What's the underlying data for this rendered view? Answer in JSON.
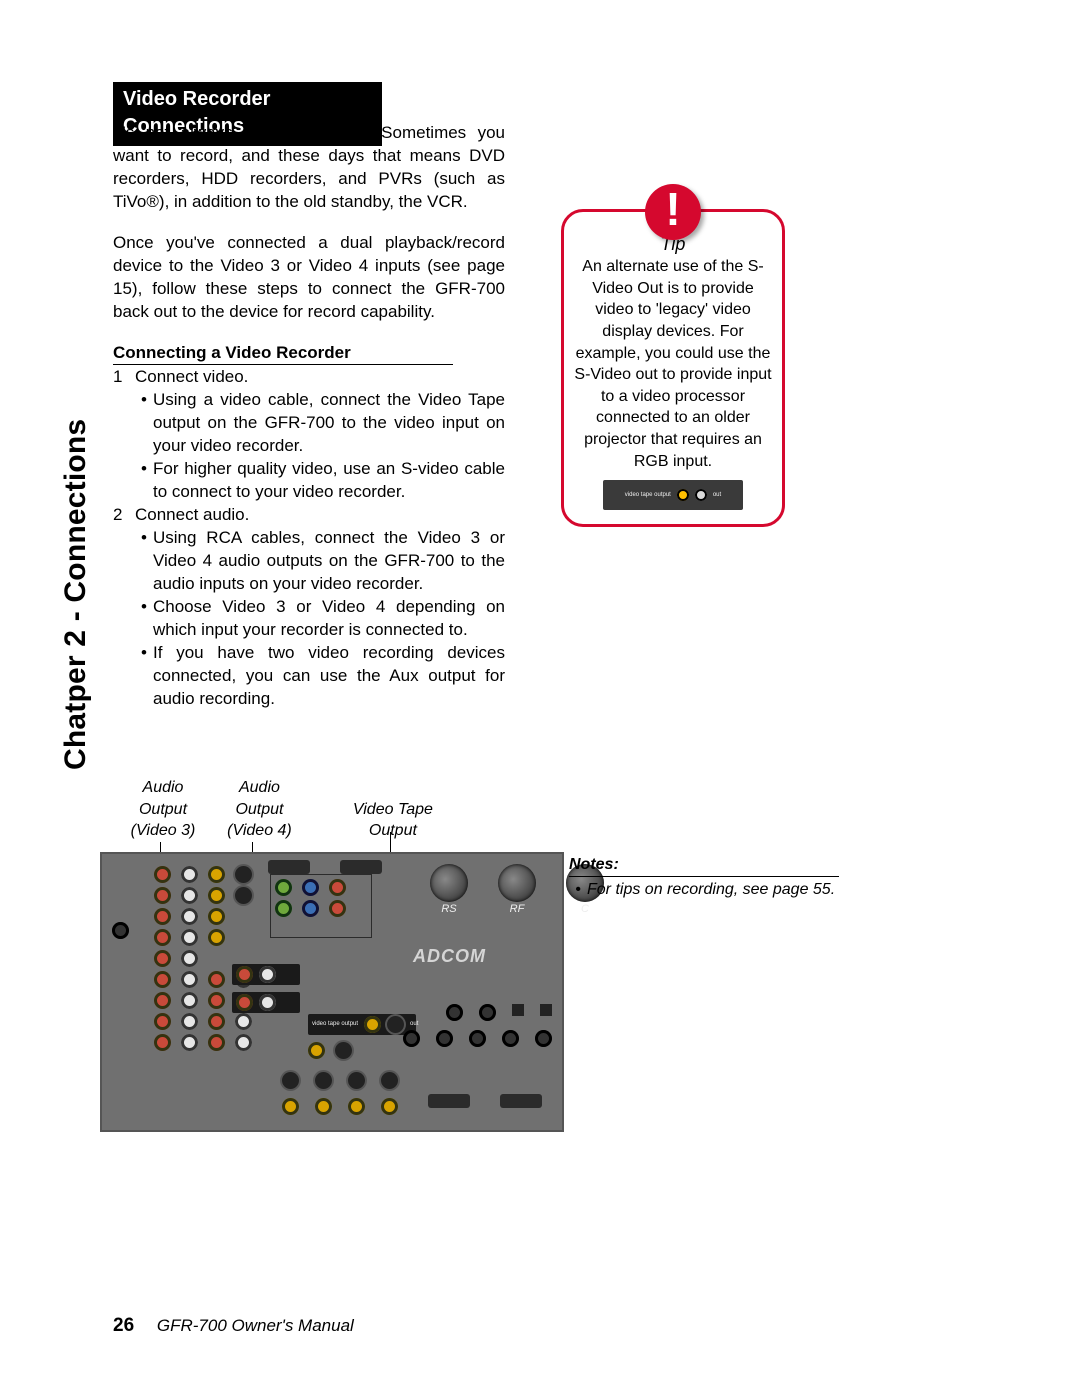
{
  "side_tab": "Chatper 2 - Connections",
  "section_title": "Video Recorder Connections",
  "intro_p1": "It's not always about playback. Sometimes you want to record, and these days that means DVD recorders, HDD recorders, and PVRs (such as TiVo®), in addition to the old standby, the VCR.",
  "intro_p2": "Once you've connected a dual playback/record device to the Video 3 or Video 4 inputs (see page 15), follow these steps to connect the GFR-700 back out to the device for record capability.",
  "sub_header": "Connecting a Video Recorder",
  "steps": [
    {
      "num": "1",
      "title": "Connect video.",
      "bullets": [
        "Using a video cable, connect the Video Tape output on the GFR-700 to the video input on your video recorder.",
        "For higher quality video, use an S-video cable to connect to your video recorder."
      ]
    },
    {
      "num": "2",
      "title": "Connect audio.",
      "bullets": [
        "Using RCA cables, connect the Video 3 or Video 4 audio outputs  on the GFR-700 to the audio inputs on your video recorder.",
        "Choose Video 3 or Video 4 depending on which input your recorder is connected to.",
        "If you have two video recording devices connected, you can use the Aux output for audio recording."
      ]
    }
  ],
  "tip": {
    "title": "Tip",
    "body": "An alternate use of the S-Video Out is to provide video to 'legacy' video display devices. For example, you could use the S-Video out to provide input to a video processor connected to an older projector that requires an RGB input.",
    "panel_label_left": "video tape output",
    "panel_label_right": "out"
  },
  "diagram_labels": {
    "audio_out_v3": "Audio Output (Video 3)",
    "audio_out_v4": "Audio Output (Video 4)",
    "video_tape_out": "Video Tape Output"
  },
  "panel": {
    "brand": "ADCOM",
    "knob_labels": [
      "RS",
      "RF",
      "C"
    ],
    "hl_video_tape": "video tape output",
    "hl_out": "out"
  },
  "notes": {
    "heading": "Notes:",
    "items": [
      "For tips on recording, see page 55."
    ]
  },
  "footer": {
    "page": "26",
    "title": "GFR-700 Owner's Manual"
  }
}
